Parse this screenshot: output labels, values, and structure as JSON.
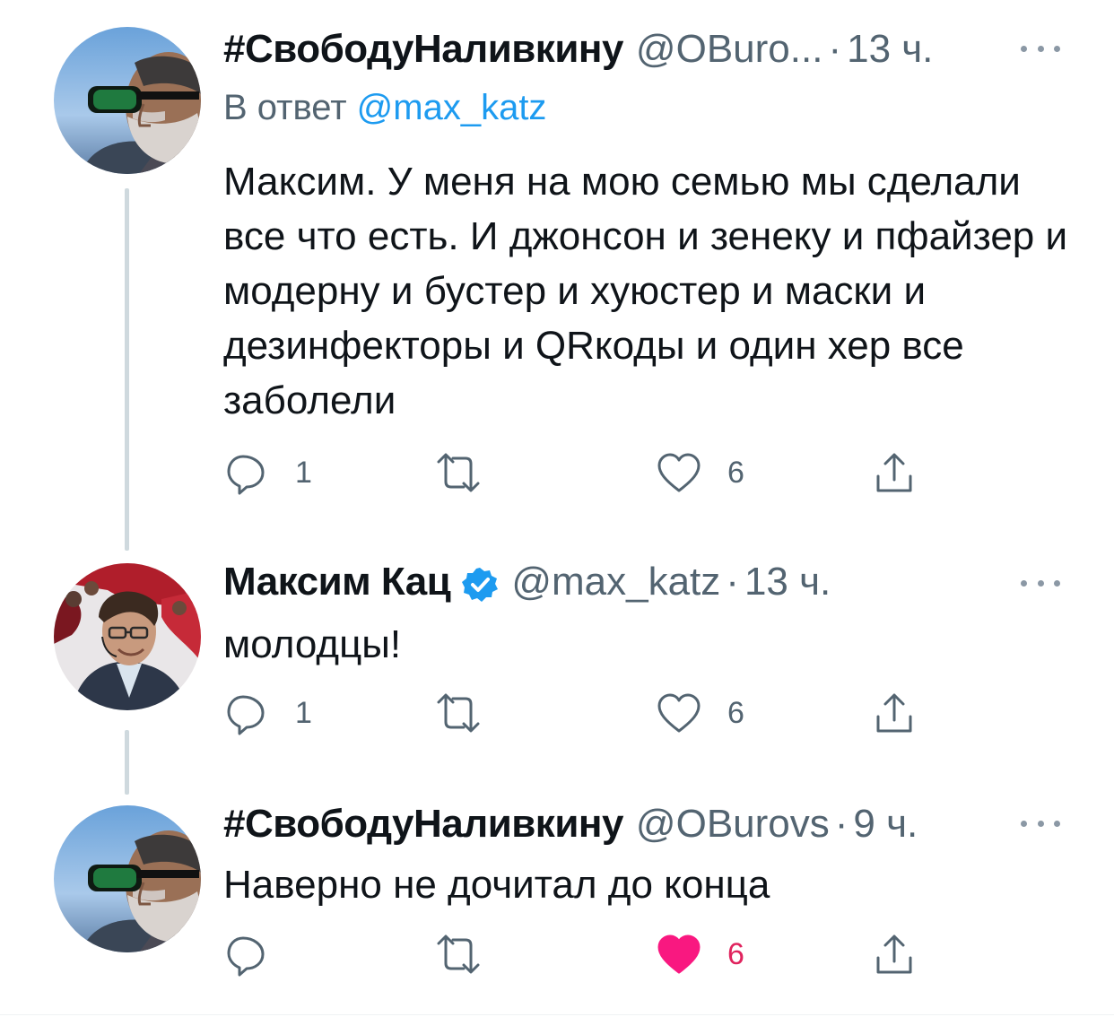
{
  "colors": {
    "text": "#0f1419",
    "secondary": "#536471",
    "link": "#1d9bf0",
    "like_active": "#f91880",
    "thread_line": "#cfd9de"
  },
  "tweets": [
    {
      "display_name": "#СвободуНаливкину",
      "handle": "@OBuro...",
      "separator": "·",
      "time": "13 ч.",
      "reply_prefix": "В ответ",
      "reply_mention": "@max_katz",
      "text": "Максим. У меня на мою семью мы сделали все что есть. И джонсон и зенеку и пфайзер и модерну и бустер и хуюстер и маски и дезинфекторы и QRкоды и один хер все заболели",
      "verified": false,
      "avatar_icon": "bearded-man-sunglasses-avatar",
      "actions": {
        "reply_count": "1",
        "retweet_count": "",
        "like_count": "6",
        "liked": false
      }
    },
    {
      "display_name": "Максим Кац",
      "handle": "@max_katz",
      "separator": "·",
      "time": "13 ч.",
      "text": "молодцы!",
      "verified": true,
      "avatar_icon": "man-with-headset-avatar",
      "actions": {
        "reply_count": "1",
        "retweet_count": "",
        "like_count": "6",
        "liked": false
      }
    },
    {
      "display_name": "#СвободуНаливкину",
      "handle": "@OBurovs",
      "separator": "·",
      "time": "9 ч.",
      "text": "Наверно не дочитал до конца",
      "verified": false,
      "avatar_icon": "bearded-man-sunglasses-avatar",
      "actions": {
        "reply_count": "",
        "retweet_count": "",
        "like_count": "6",
        "liked": true
      }
    }
  ]
}
